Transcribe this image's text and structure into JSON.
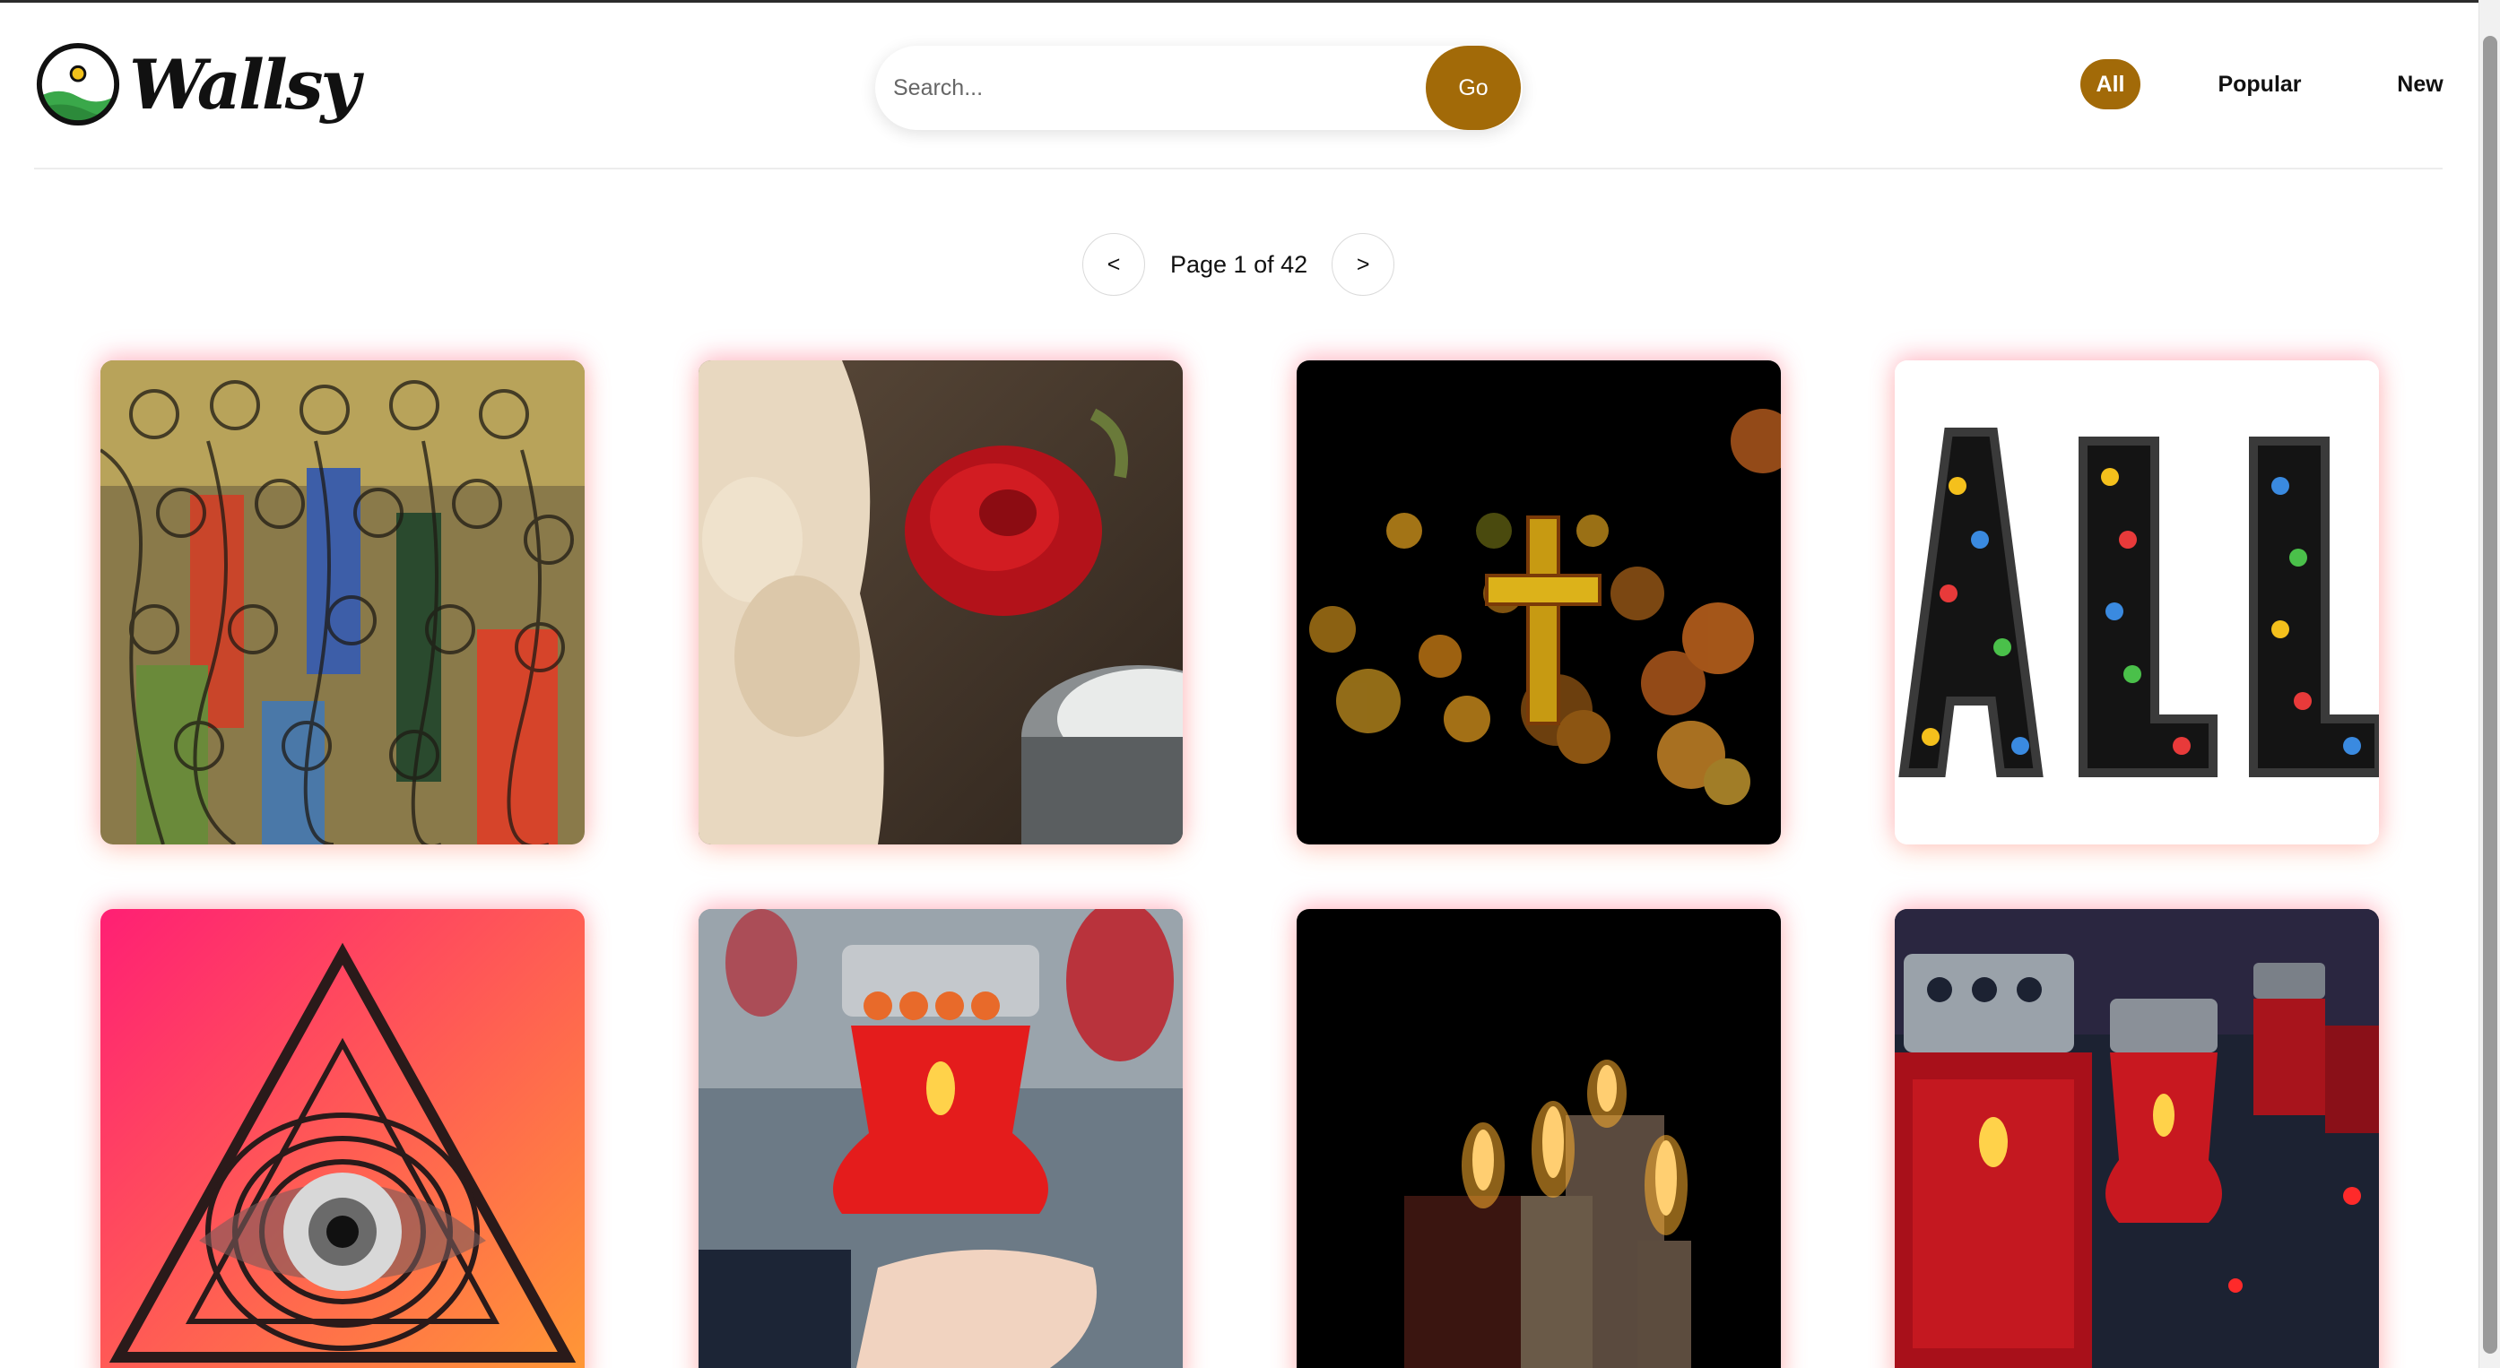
{
  "brand": {
    "name": "Wallsy",
    "accent_color": "#a26a08"
  },
  "search": {
    "placeholder": "Search...",
    "value": "",
    "button_label": "Go"
  },
  "nav": {
    "items": [
      {
        "label": "All",
        "active": true
      },
      {
        "label": "Popular",
        "active": false
      },
      {
        "label": "New",
        "active": false
      }
    ]
  },
  "pagination": {
    "prev_label": "<",
    "next_label": ">",
    "text": "Page 1 of 42",
    "current_page": 1,
    "total_pages": 42
  },
  "wallpapers": [
    {
      "subject": "stained-glass-saints-artwork"
    },
    {
      "subject": "angel-figurine-rose-candle"
    },
    {
      "subject": "golden-cross-bokeh"
    },
    {
      "subject": "all-emoji-letters"
    },
    {
      "subject": "eye-in-triangle-gradient"
    },
    {
      "subject": "hand-holding-red-grave-candle"
    },
    {
      "subject": "burning-candles-dark"
    },
    {
      "subject": "red-grave-lanterns"
    }
  ]
}
